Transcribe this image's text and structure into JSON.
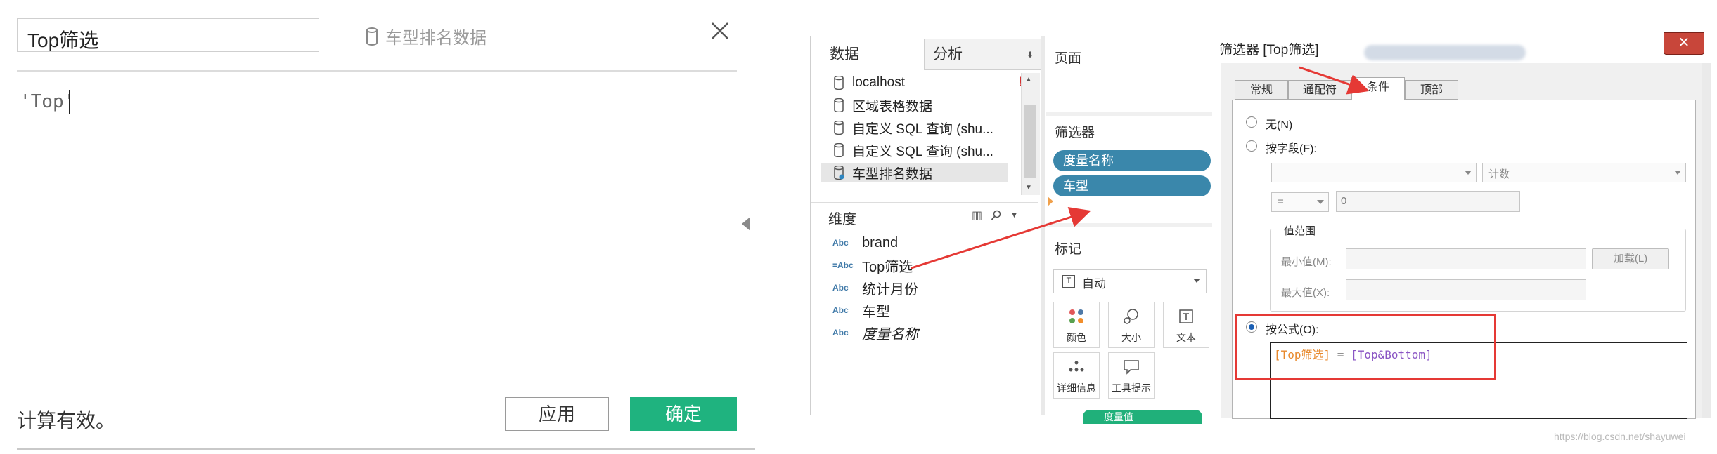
{
  "calc_editor": {
    "name": "Top筛选",
    "datasource": "车型排名数据",
    "formula": "'Top'",
    "status": "计算有效。",
    "apply_label": "应用",
    "ok_label": "确定"
  },
  "data_pane": {
    "tab_data": "数据",
    "tab_analysis": "分析",
    "datasources": [
      "localhost",
      "区域表格数据",
      "自定义 SQL 查询 (shu...",
      "自定义 SQL 查询 (shu...",
      "车型排名数据"
    ],
    "alert_mark": "!",
    "dimensions_header": "维度",
    "field_type": "Abc",
    "field_type_calc": "=Abc",
    "fields": [
      "brand",
      "Top筛选",
      "统计月份",
      "车型",
      "度量名称"
    ]
  },
  "shelves": {
    "pages_title": "页面",
    "filters_title": "筛选器",
    "filter_pills": [
      "度量名称",
      "车型"
    ],
    "marks_title": "标记",
    "marks_type": "自动",
    "mark_buttons": [
      "颜色",
      "大小",
      "文本",
      "详细信息",
      "工具提示"
    ],
    "bottom_pill": "度量值"
  },
  "filter_dialog": {
    "title": "筛选器 [Top筛选]",
    "close_glyph": "✕",
    "tabs": [
      "常规",
      "通配符",
      "条件",
      "顶部"
    ],
    "active_tab": "条件",
    "opt_none": "无(N)",
    "opt_by_field": "按字段(F):",
    "agg_value": "计数",
    "operator": "=",
    "value": "0",
    "range_title": "值范围",
    "min_label": "最小值(M):",
    "max_label": "最大值(X):",
    "load_label": "加载(L)",
    "opt_by_formula": "按公式(O):",
    "formula_field": "[Top筛选]",
    "formula_eq": " = ",
    "formula_param": "[Top&Bottom]"
  },
  "watermark": "https://blog.csdn.net/shayuwei",
  "colors": {
    "ok_green": "#1fb37f",
    "pill_blue": "#3a87ab",
    "annotation_red": "#e53935"
  }
}
